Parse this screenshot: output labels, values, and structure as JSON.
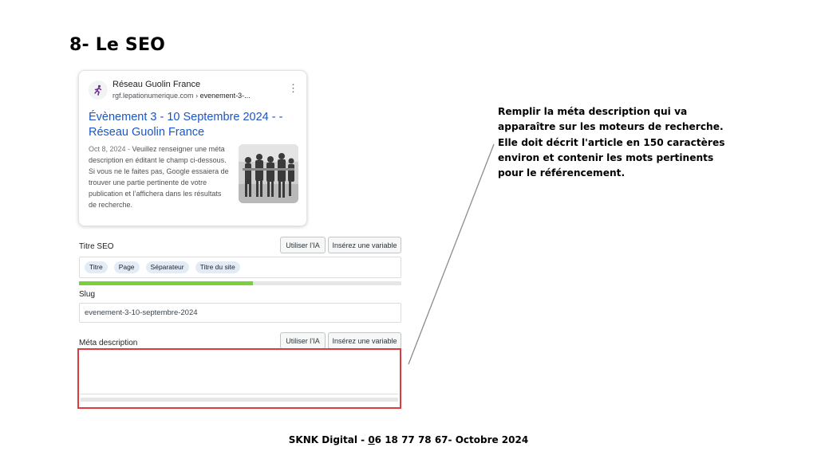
{
  "page_title": "8- Le SEO",
  "preview": {
    "site_name": "Réseau Guolin France",
    "site_url_domain": "rgf.lepationumerique.com",
    "site_url_separator": " › ",
    "site_url_path": "evenement-3-...",
    "title": "Évènement 3 - 10 Septembre 2024 - - Réseau Guolin France",
    "date": "Oct 8, 2024",
    "date_separator": " - ",
    "snippet": "Veuillez renseigner une méta description en éditant le champ ci-dessous. Si vous ne le faites pas, Google essaiera de trouver une partie pertinente de votre publication et l’affichera dans les résultats de recherche.",
    "menu_glyph": "⋮"
  },
  "seo_title": {
    "label": "Titre SEO",
    "ai_button": "Utiliser l’IA",
    "variable_button": "Insérez une variable",
    "chips": [
      "Titre",
      "Page",
      "Séparateur",
      "Titre du site"
    ],
    "progress": 0.54
  },
  "slug": {
    "label": "Slug",
    "value": "evenement-3-10-septembre-2024"
  },
  "meta_description": {
    "label": "Méta description",
    "ai_button": "Utiliser l’IA",
    "variable_button": "Insérez une variable",
    "value": ""
  },
  "annotation": "Remplir la méta description qui va apparaître sur les moteurs de recherche. Elle doit décrit l'article en 150 caractères environ et contenir les mots pertinents pour le référencement.",
  "footer": {
    "before": "SKNK Digital - ",
    "underlined": "0",
    "after": "6 18 77 78 67- Octobre 2024"
  },
  "colors": {
    "title_link": "#1a56c5",
    "progress_good": "#7ad03a",
    "highlight_border": "#e0393e"
  }
}
